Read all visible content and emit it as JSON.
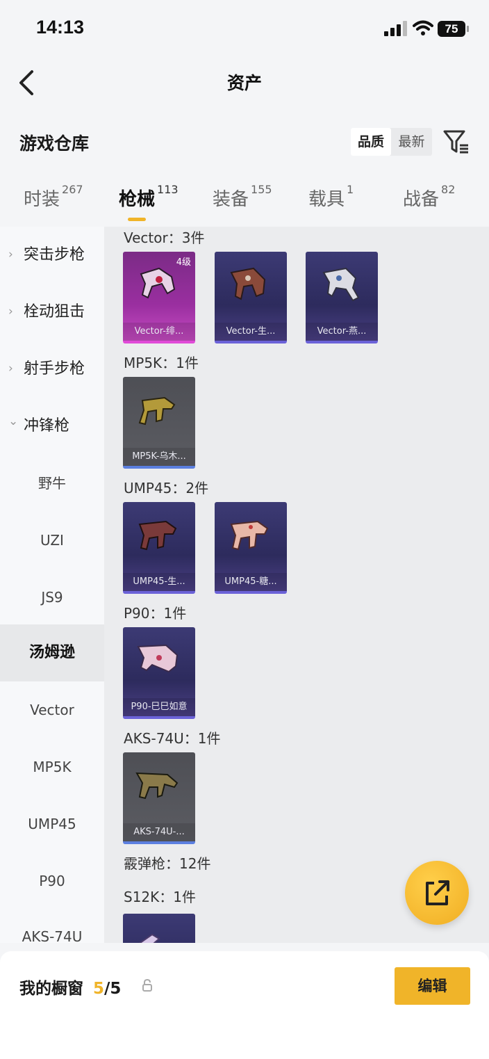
{
  "status": {
    "time": "14:13",
    "battery": "75"
  },
  "header": {
    "title": "资产"
  },
  "section": {
    "title": "游戏仓库",
    "sort_quality": "品质",
    "sort_latest": "最新"
  },
  "tabs": [
    {
      "label": "时装",
      "count": "267"
    },
    {
      "label": "枪械",
      "count": "113",
      "active": true
    },
    {
      "label": "装备",
      "count": "155"
    },
    {
      "label": "载具",
      "count": "1"
    },
    {
      "label": "战备",
      "count": "82"
    }
  ],
  "sidebar": {
    "categories": [
      {
        "label": "突击步枪",
        "chevron": "›"
      },
      {
        "label": "栓动狙击",
        "chevron": "›"
      },
      {
        "label": "射手步枪",
        "chevron": "›"
      },
      {
        "label": "冲锋枪",
        "chevron": "⌄"
      }
    ],
    "subitems": [
      {
        "label": "野牛"
      },
      {
        "label": "UZI"
      },
      {
        "label": "JS9"
      },
      {
        "label": "汤姆逊",
        "selected": true
      },
      {
        "label": "Vector"
      },
      {
        "label": "MP5K"
      },
      {
        "label": "UMP45"
      },
      {
        "label": "P90"
      },
      {
        "label": "AKS-74U"
      }
    ]
  },
  "groups": [
    {
      "title": "Vector：3件",
      "items": [
        {
          "name": "Vector-绯...",
          "level": "4级",
          "rarity": "pink"
        },
        {
          "name": "Vector-生...",
          "rarity": "purple"
        },
        {
          "name": "Vector-燕...",
          "rarity": "purple"
        }
      ]
    },
    {
      "title": "MP5K：1件",
      "items": [
        {
          "name": "MP5K-乌木...",
          "rarity": "gray"
        }
      ]
    },
    {
      "title": "UMP45：2件",
      "items": [
        {
          "name": "UMP45-生...",
          "rarity": "purple"
        },
        {
          "name": "UMP45-糖...",
          "rarity": "purple"
        }
      ]
    },
    {
      "title": "P90：1件",
      "items": [
        {
          "name": "P90-巳巳如意",
          "rarity": "purple"
        }
      ]
    },
    {
      "title": "AKS-74U：1件",
      "items": [
        {
          "name": "AKS-74U-...",
          "rarity": "gray"
        }
      ]
    },
    {
      "title": "霰弹枪：12件",
      "items": []
    },
    {
      "title": "S12K：1件",
      "items": [
        {
          "name": "",
          "rarity": "purple"
        }
      ]
    }
  ],
  "showcase": {
    "label": "我的橱窗",
    "current": "5",
    "total": "/5",
    "edit": "编辑"
  },
  "icons": {
    "back": "back-arrow-icon",
    "filter": "filter-icon",
    "share": "share-icon",
    "lock": "lock-icon"
  }
}
